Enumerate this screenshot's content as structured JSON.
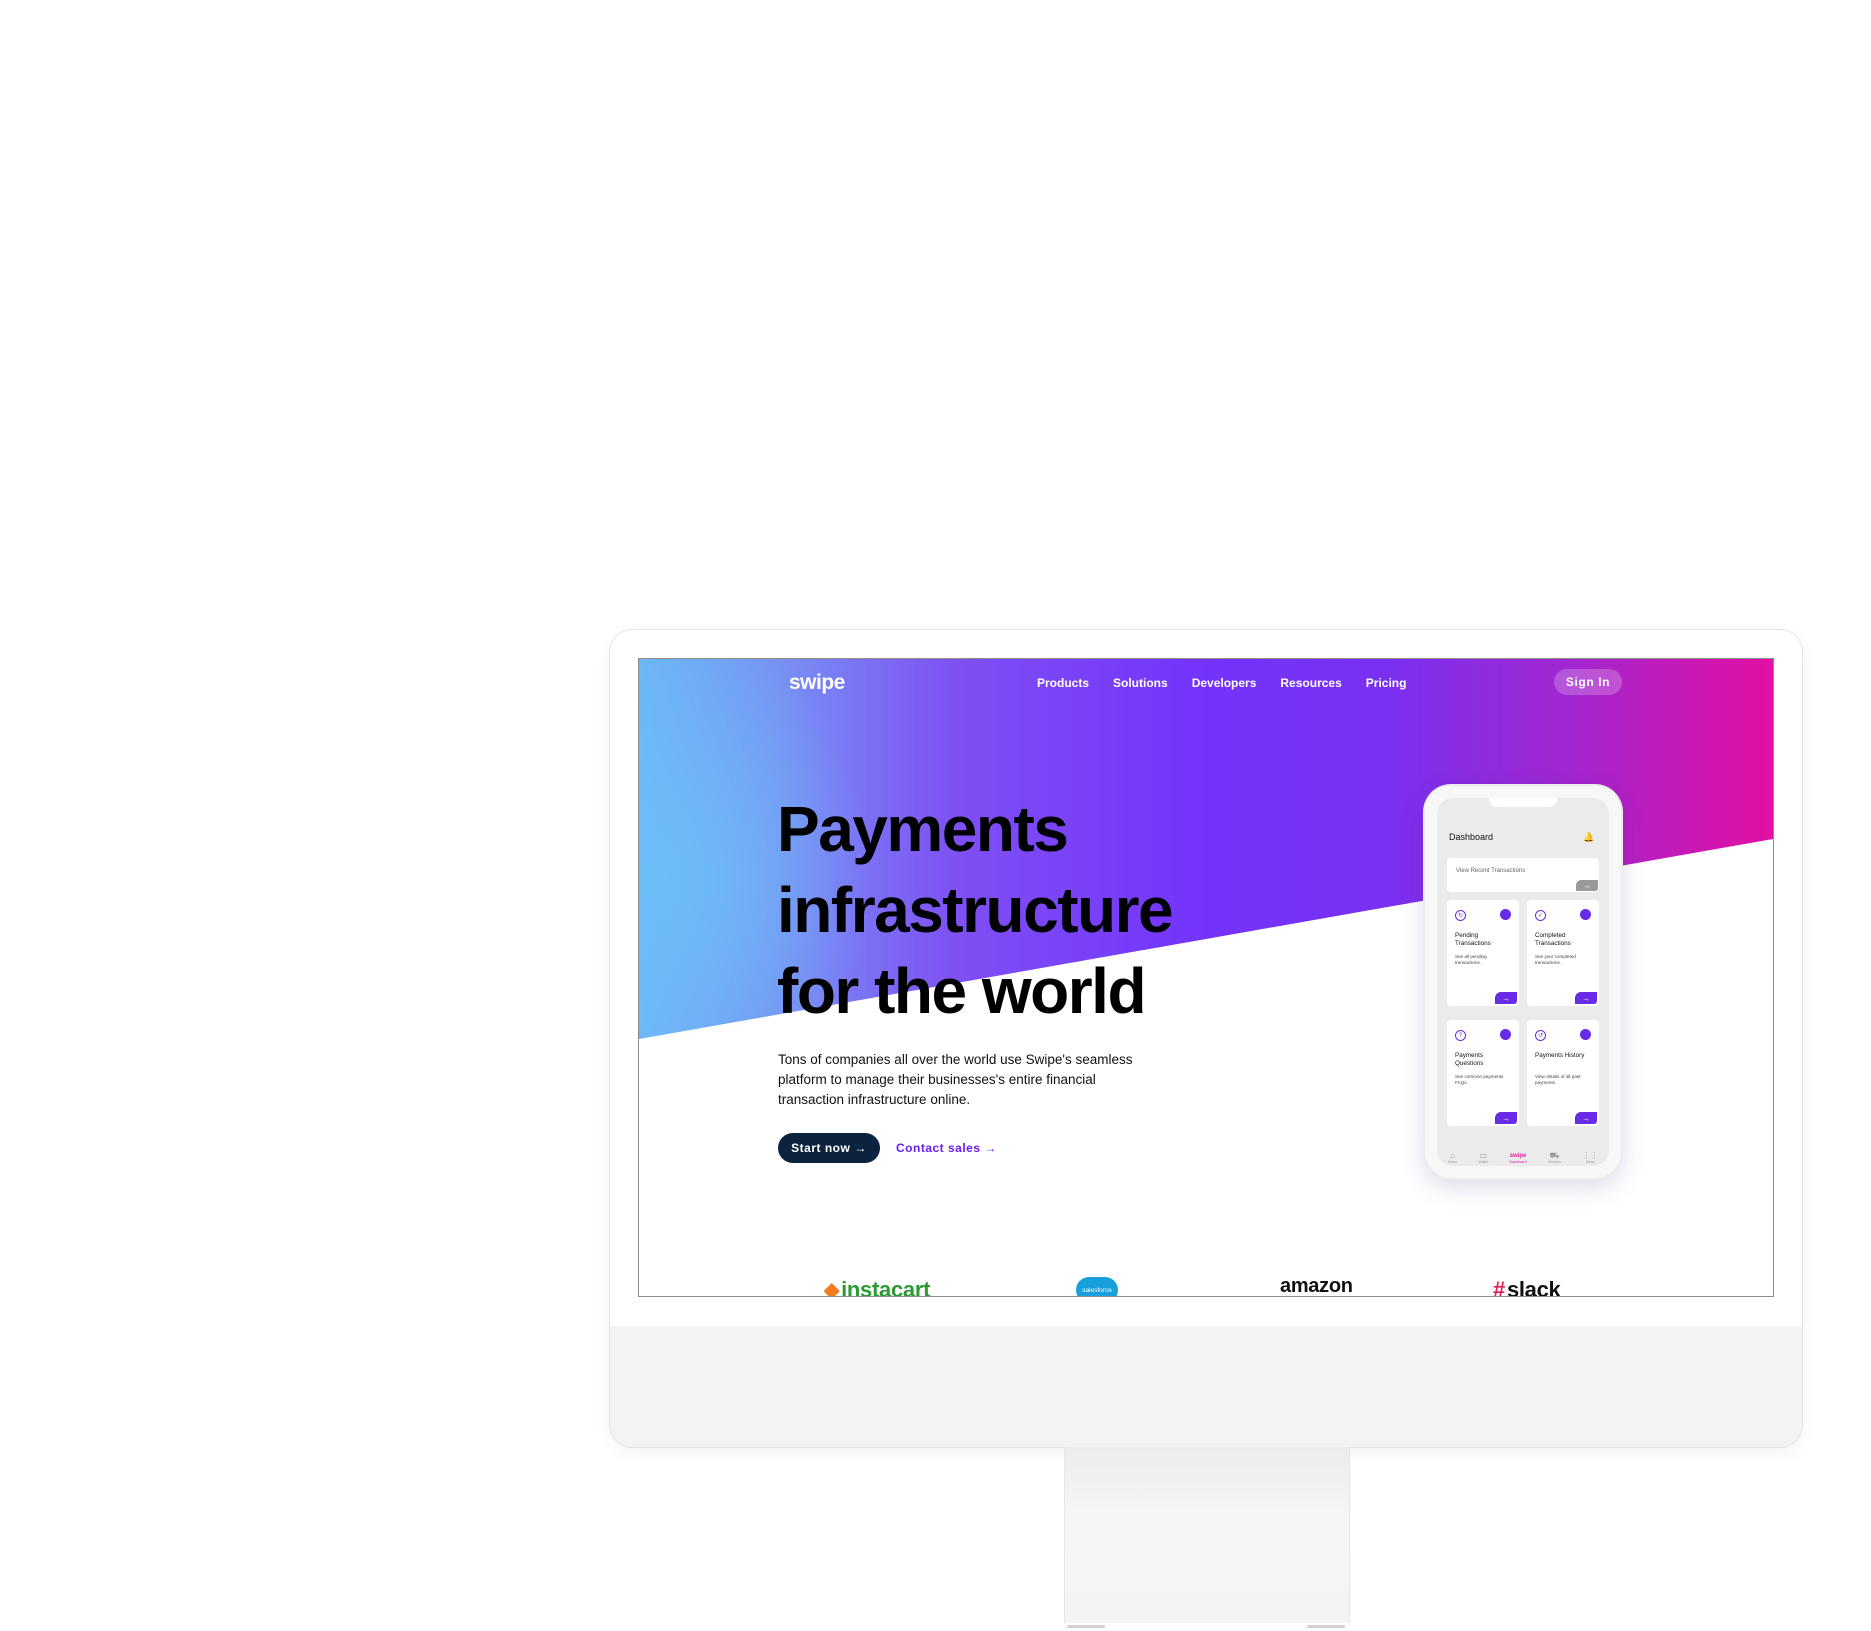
{
  "nav": {
    "logo": "swipe",
    "items": [
      "Products",
      "Solutions",
      "Developers",
      "Resources",
      "Pricing"
    ],
    "signin": "Sign In"
  },
  "hero": {
    "headline": [
      "Payments",
      "infrastructure",
      "for the world"
    ],
    "subtitle": "Tons of companies all over the world use Swipe's seamless platform to manage their businesses's entire financial transaction infrastructure online.",
    "cta_primary": "Start now",
    "cta_secondary": "Contact sales",
    "arrow": "→"
  },
  "phone": {
    "title": "Dashboard",
    "bell_icon": "🔔",
    "recent": "View Recent Transactions",
    "cards": [
      {
        "icon": "↻",
        "title": "Pending Transactions",
        "desc": "See all pending transactions."
      },
      {
        "icon": "✓",
        "title": "Completed Transactions",
        "desc": "See your completed transactions."
      },
      {
        "icon": "?",
        "title": "Payments Questions",
        "desc": "See common payments FAQs."
      },
      {
        "icon": "↺",
        "title": "Payments History",
        "desc": "View details of all past payments."
      }
    ],
    "tabs": [
      {
        "icon": "⌂",
        "label": "Home"
      },
      {
        "icon": "▭",
        "label": "Wallet"
      },
      {
        "icon": "swipe",
        "label": "Dashboard"
      },
      {
        "icon": "⛟",
        "label": "Vendors"
      },
      {
        "icon": "⋮⋮",
        "label": "Menu"
      }
    ]
  },
  "logos": {
    "instacart": "instacart",
    "salesforce": "salesforce",
    "amazon": "amazon",
    "slack": "slack"
  },
  "colors": {
    "primary_button": "#0c2340",
    "accent_purple": "#6a2be6",
    "gradient": [
      "#6cb6f6",
      "#7333fb",
      "#e40fa2"
    ]
  }
}
